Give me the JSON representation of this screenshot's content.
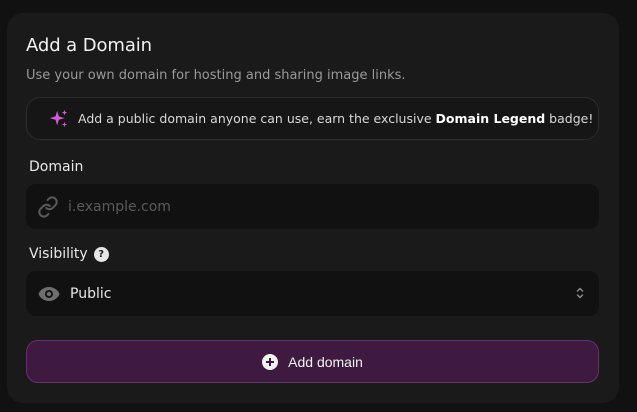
{
  "card": {
    "title": "Add a Domain",
    "subtitle": "Use your own domain for hosting and sharing image links."
  },
  "banner": {
    "icon": "sparkles-icon",
    "text_before": "Add a public domain anyone can use, earn the exclusive ",
    "highlight": "Domain Legend",
    "text_after": " badge!",
    "icon_color": "#d65ad8"
  },
  "domain_field": {
    "label": "Domain",
    "icon": "link-icon",
    "placeholder": "i.example.com",
    "value": ""
  },
  "visibility_field": {
    "label": "Visibility",
    "help_icon": "question-circle-icon",
    "help_glyph": "?",
    "icon": "eye-icon",
    "selected": "Public",
    "chevron_icon": "chevron-up-down-icon"
  },
  "submit": {
    "icon": "plus-circle-icon",
    "label": "Add domain",
    "accent": "#3e1a40",
    "border": "#66306a"
  }
}
